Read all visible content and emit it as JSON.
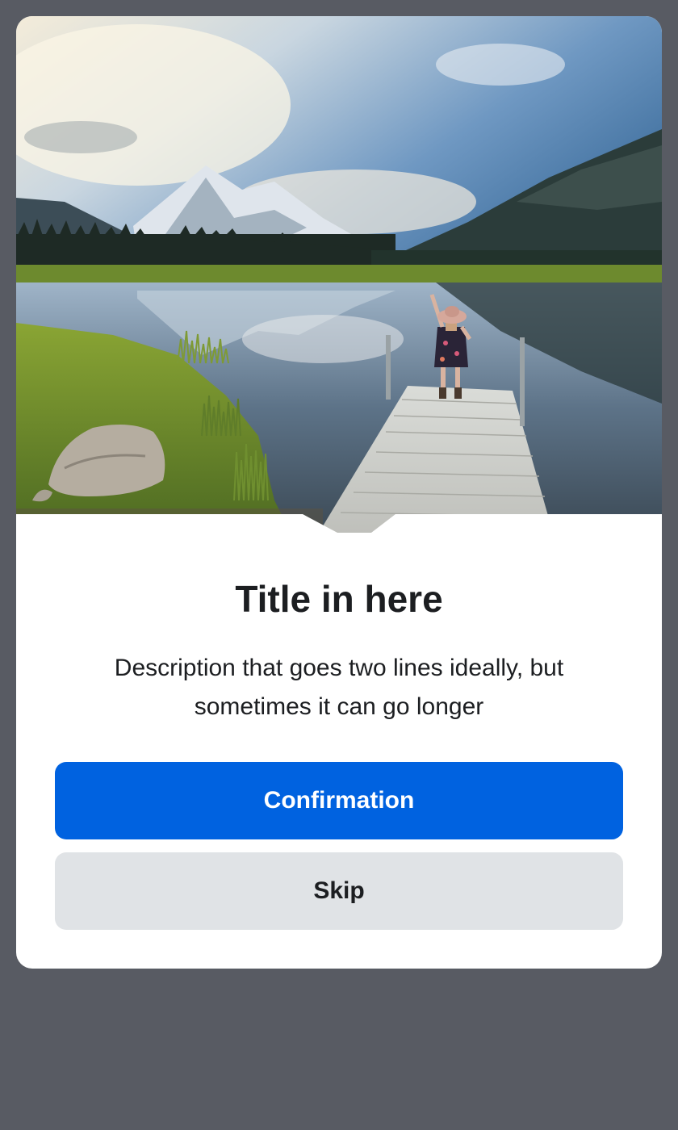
{
  "dialog": {
    "title": "Title in here",
    "description": "Description that goes two lines ideally, but sometimes it can go longer",
    "confirm_label": "Confirmation",
    "skip_label": "Skip"
  },
  "colors": {
    "backdrop": "#585b63",
    "card": "#ffffff",
    "primary": "#0062e0",
    "secondary": "#e0e3e6",
    "text": "#1c1e21"
  }
}
